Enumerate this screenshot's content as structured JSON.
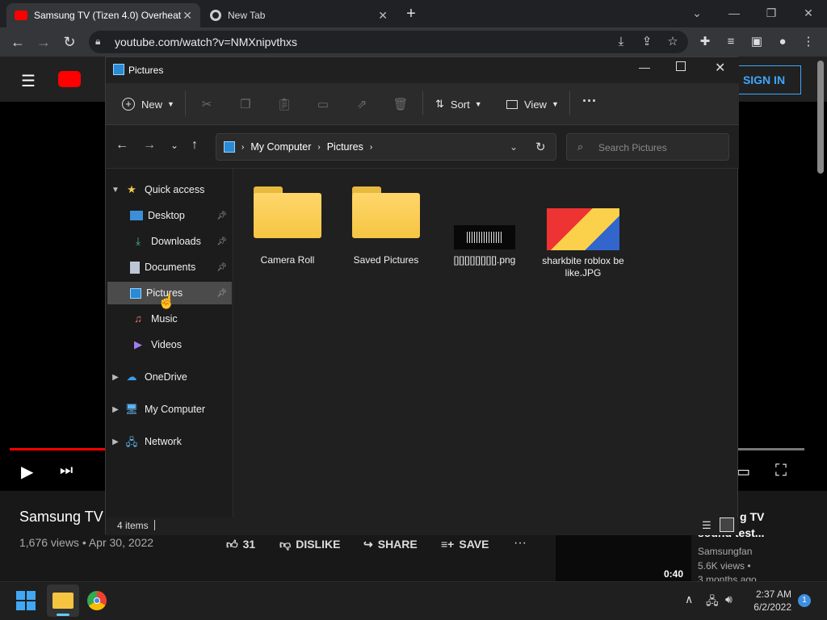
{
  "browser": {
    "tabs": [
      {
        "title": "Samsung TV (Tizen 4.0) Overheat",
        "active": true
      },
      {
        "title": "New Tab",
        "active": false
      }
    ],
    "url": "youtube.com/watch?v=NMXnipvthxs"
  },
  "youtube": {
    "sign_in": "SIGN IN",
    "video_title": "Samsung TV",
    "views_date": "1,676 views • Apr 30, 2022",
    "likes": "31",
    "dislike": "DISLIKE",
    "share": "SHARE",
    "save": "SAVE",
    "side_title": "g TV",
    "side_title2": "sound test...",
    "side_channel": "Samsungfan",
    "side_views": "5.6K views •",
    "side_age": "3 months ago",
    "side_duration": "0:40"
  },
  "explorer": {
    "title": "Pictures",
    "cmd": {
      "new": "New",
      "sort": "Sort",
      "view": "View"
    },
    "breadcrumb": [
      "My Computer",
      "Pictures"
    ],
    "search_placeholder": "Search Pictures",
    "nav": {
      "quick_access": "Quick access",
      "desktop": "Desktop",
      "downloads": "Downloads",
      "documents": "Documents",
      "pictures": "Pictures",
      "music": "Music",
      "videos": "Videos",
      "onedrive": "OneDrive",
      "my_computer": "My Computer",
      "network": "Network"
    },
    "files": [
      {
        "name": "Camera Roll"
      },
      {
        "name": "Saved Pictures"
      },
      {
        "name": "[][][][][][][][].png"
      },
      {
        "name": "sharkbite roblox be like.JPG"
      }
    ],
    "status": "4 items"
  },
  "taskbar": {
    "time": "2:37 AM",
    "date": "6/2/2022",
    "notif_count": "1"
  },
  "colors": {
    "accent": "#3ea6ff",
    "yt_red": "#ff0000",
    "folder": "#f5c542"
  }
}
